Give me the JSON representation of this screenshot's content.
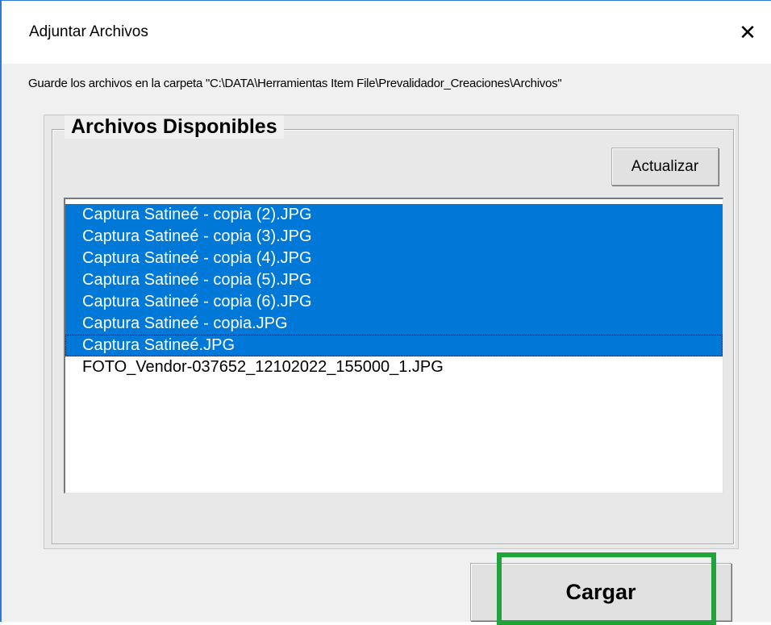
{
  "window": {
    "title": "Adjuntar Archivos",
    "close_glyph": "✕"
  },
  "instruction": "Guarde los archivos en la carpeta \"C:\\DATA\\Herramientas Item File\\Prevalidador_Creaciones\\Archivos\"",
  "frame": {
    "legend": "Archivos Disponibles",
    "refresh_label": "Actualizar"
  },
  "files": [
    {
      "name": "Captura Satineé - copia (2).JPG",
      "selected": true
    },
    {
      "name": "Captura Satineé - copia (3).JPG",
      "selected": true
    },
    {
      "name": "Captura Satineé - copia (4).JPG",
      "selected": true
    },
    {
      "name": "Captura Satineé - copia (5).JPG",
      "selected": true
    },
    {
      "name": "Captura Satineé - copia (6).JPG",
      "selected": true
    },
    {
      "name": "Captura Satineé - copia.JPG",
      "selected": true
    },
    {
      "name": "Captura Satineé.JPG",
      "selected": true,
      "focused": true
    },
    {
      "name": "FOTO_Vendor-037652_12102022_155000_1.JPG",
      "selected": false
    }
  ],
  "upload_label": "Cargar",
  "colors": {
    "selection": "#0078d7",
    "highlight_box": "#1fa33a",
    "window_border": "#2b7bd4"
  }
}
